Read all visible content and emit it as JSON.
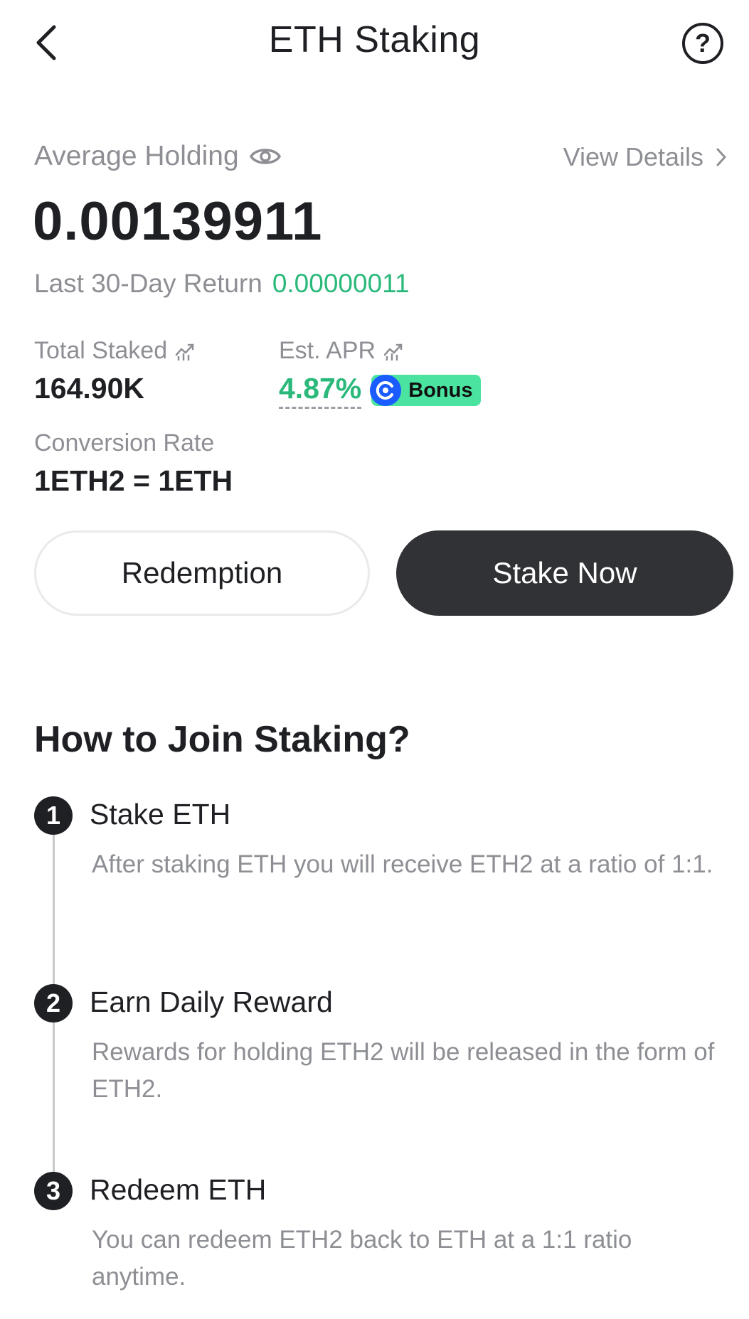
{
  "header": {
    "title": "ETH Staking",
    "back_icon": "chevron-left-icon",
    "help_icon": "question-circle-icon",
    "help_glyph": "?"
  },
  "holding": {
    "label": "Average Holding",
    "visibility_icon": "eye-icon",
    "view_details_label": "View Details",
    "value": "0.00139911",
    "return_label": "Last 30-Day Return",
    "return_value": "0.00000011"
  },
  "stats": {
    "total_staked_label": "Total Staked",
    "total_staked_value": "164.90K",
    "apr_label": "Est. APR",
    "apr_value": "4.87%",
    "bonus_label": "Bonus",
    "conversion_label": "Conversion Rate",
    "conversion_value": "1ETH2 = 1ETH"
  },
  "actions": {
    "redemption_label": "Redemption",
    "stake_now_label": "Stake Now"
  },
  "how_to": {
    "title": "How to Join Staking?",
    "steps": [
      {
        "number": "1",
        "title": "Stake ETH",
        "description": "After staking ETH you will receive ETH2 at a ratio of 1:1."
      },
      {
        "number": "2",
        "title": "Earn Daily Reward",
        "description": "Rewards for holding ETH2 will be released in the form of ETH2."
      },
      {
        "number": "3",
        "title": "Redeem ETH",
        "description": "You can redeem ETH2 back to ETH at a 1:1 ratio anytime."
      }
    ]
  },
  "colors": {
    "accent_green": "#2bb97b",
    "bonus_green": "#4be3a0",
    "bonus_blue": "#1a5cff",
    "primary_dark": "#313236",
    "muted_text": "#8d8f94"
  }
}
